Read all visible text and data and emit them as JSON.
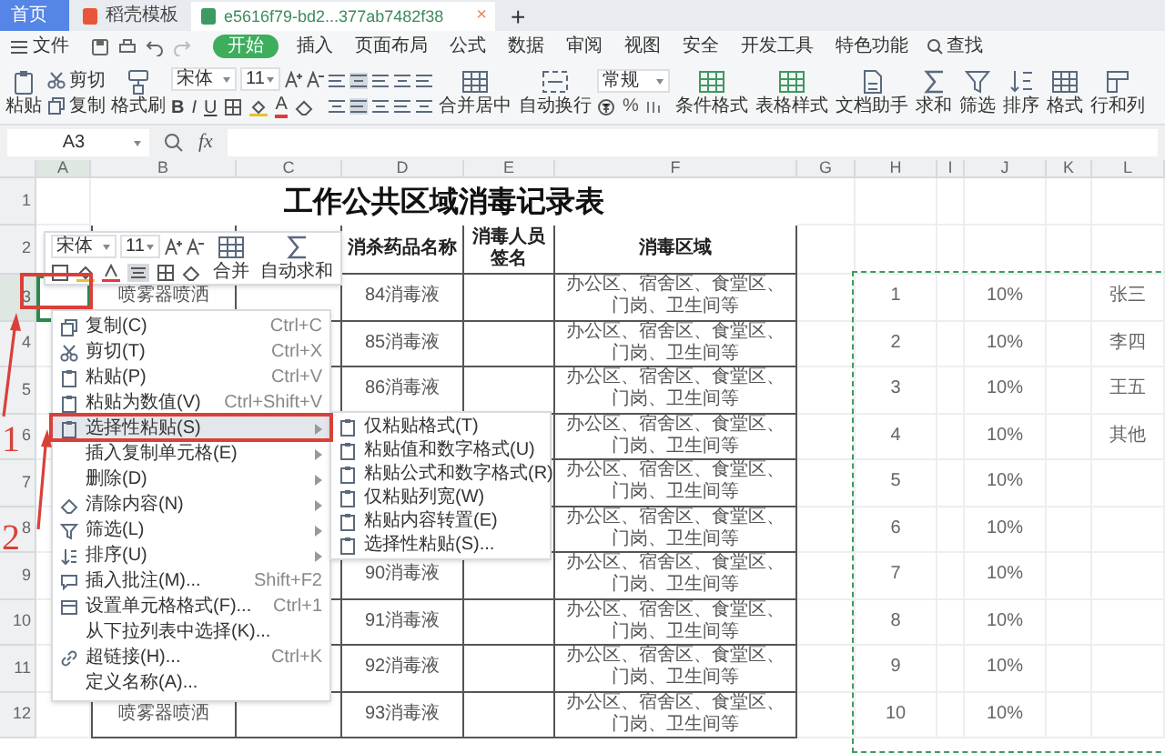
{
  "tabs": [
    {
      "label": "首页",
      "selected": false
    },
    {
      "label": "稻壳模板",
      "selected": false
    },
    {
      "label": "e5616f79-bd2...377ab7482f38",
      "selected": true,
      "close": "×"
    }
  ],
  "new_tab": "+",
  "menu": {
    "file": "文件",
    "tabs": [
      {
        "label": "开始",
        "selected": true
      },
      {
        "label": "插入",
        "selected": false
      },
      {
        "label": "页面布局",
        "selected": false
      },
      {
        "label": "公式",
        "selected": false
      },
      {
        "label": "数据",
        "selected": false
      },
      {
        "label": "审阅",
        "selected": false
      },
      {
        "label": "视图",
        "selected": false
      },
      {
        "label": "安全",
        "selected": false
      },
      {
        "label": "开发工具",
        "selected": false
      },
      {
        "label": "特色功能",
        "selected": false
      }
    ],
    "search": "查找"
  },
  "ribbon": {
    "paste": "粘贴",
    "cut": "剪切",
    "copy": "复制",
    "format_painter": "格式刷",
    "font": "宋体",
    "size": "11",
    "format_buttons": [
      "B",
      "I",
      "U"
    ],
    "font_color": "A",
    "merge": "合并居中",
    "wrap": "自动换行",
    "number_format": "常规",
    "percent": "%",
    "buttons": [
      "条件格式",
      "表格样式",
      "文档助手",
      "求和",
      "筛选",
      "排序",
      "格式",
      "行和列"
    ]
  },
  "formula_bar": {
    "name_box": "A3",
    "fx": "fx"
  },
  "columns": [
    "A",
    "B",
    "C",
    "D",
    "E",
    "F",
    "G",
    "H",
    "I",
    "J",
    "K",
    "L"
  ],
  "row_numbers": [
    "1",
    "2",
    "3",
    "4",
    "5",
    "6",
    "7",
    "8",
    "9",
    "10",
    "11",
    "12"
  ],
  "sheet": {
    "title": "工作公共区域消毒记录表",
    "rows": [
      {
        "D": "消杀药品名称",
        "E": "消毒人员签名",
        "F": "消毒区域"
      },
      {
        "B": "喷雾器喷洒",
        "D": "84消毒液",
        "F": "办公区、宿舍区、食堂区、门岗、卫生间等",
        "H": "1",
        "J": "10%",
        "L": "张三"
      },
      {
        "D": "85消毒液",
        "F": "办公区、宿舍区、食堂区、门岗、卫生间等",
        "H": "2",
        "J": "10%",
        "L": "李四"
      },
      {
        "D": "86消毒液",
        "F": "办公区、宿舍区、食堂区、门岗、卫生间等",
        "H": "3",
        "J": "10%",
        "L": "王五"
      },
      {
        "F": "办公区、宿舍区、食堂区、门岗、卫生间等",
        "H": "4",
        "J": "10%",
        "L": "其他"
      },
      {
        "F": "办公区、宿舍区、食堂区、门岗、卫生间等",
        "H": "5",
        "J": "10%"
      },
      {
        "F": "办公区、宿舍区、食堂区、门岗、卫生间等",
        "H": "6",
        "J": "10%"
      },
      {
        "D": "90消毒液",
        "F": "办公区、宿舍区、食堂区、门岗、卫生间等",
        "H": "7",
        "J": "10%"
      },
      {
        "D": "91消毒液",
        "F": "办公区、宿舍区、食堂区、门岗、卫生间等",
        "H": "8",
        "J": "10%"
      },
      {
        "D": "92消毒液",
        "F": "办公区、宿舍区、食堂区、门岗、卫生间等",
        "H": "9",
        "J": "10%"
      },
      {
        "B": "喷雾器喷洒",
        "D": "93消毒液",
        "F": "办公区、宿舍区、食堂区、门岗、卫生间等",
        "H": "10",
        "J": "10%"
      }
    ]
  },
  "mini_toolbar": {
    "font": "宋体",
    "size": "11",
    "merge": "合并",
    "autosum": "自动求和"
  },
  "context_menu": [
    {
      "label": "复制(C)",
      "shortcut": "Ctrl+C",
      "selected": false
    },
    {
      "label": "剪切(T)",
      "shortcut": "Ctrl+X",
      "selected": false
    },
    {
      "label": "粘贴(P)",
      "shortcut": "Ctrl+V",
      "selected": false
    },
    {
      "label": "粘贴为数值(V)",
      "shortcut": "Ctrl+Shift+V",
      "selected": false
    },
    {
      "label": "选择性粘贴(S)",
      "submenu": true,
      "selected": true
    },
    {
      "label": "插入复制单元格(E)",
      "submenu": true,
      "selected": false
    },
    {
      "label": "删除(D)",
      "submenu": true,
      "selected": false
    },
    {
      "label": "清除内容(N)",
      "submenu": true,
      "selected": false
    },
    {
      "label": "筛选(L)",
      "submenu": true,
      "selected": false
    },
    {
      "label": "排序(U)",
      "submenu": true,
      "selected": false
    },
    {
      "label": "插入批注(M)...",
      "shortcut": "Shift+F2",
      "selected": false
    },
    {
      "label": "设置单元格格式(F)...",
      "shortcut": "Ctrl+1",
      "selected": false
    },
    {
      "label": "从下拉列表中选择(K)...",
      "selected": false
    },
    {
      "label": "超链接(H)...",
      "shortcut": "Ctrl+K",
      "selected": false
    },
    {
      "label": "定义名称(A)...",
      "selected": false
    }
  ],
  "submenu": [
    "仅粘贴格式(T)",
    "粘贴值和数字格式(U)",
    "粘贴公式和数字格式(R)",
    "仅粘贴列宽(W)",
    "粘贴内容转置(E)",
    "选择性粘贴(S)..."
  ],
  "annotations": [
    "1",
    "2"
  ]
}
